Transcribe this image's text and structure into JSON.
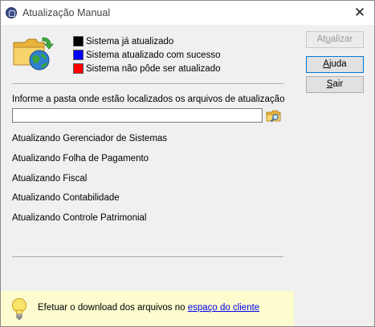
{
  "window": {
    "title": "Atualização Manual"
  },
  "legend": [
    {
      "label": "Sistema já atualizado",
      "color": "#000000"
    },
    {
      "label": "Sistema atualizado com sucesso",
      "color": "#0000ff"
    },
    {
      "label": "Sistema não pôde ser atualizado",
      "color": "#ff0000"
    }
  ],
  "folder": {
    "prompt": "Informe a pasta onde estão localizados os arquivos de atualização",
    "value": "",
    "placeholder": ""
  },
  "status_lines": [
    "Atualizando Gerenciador de Sistemas",
    "Atualizando Folha de Pagamento",
    "Atualizando Fiscal",
    "Atualizando Contabilidade",
    "Atualizando Controle Patrimonial"
  ],
  "buttons": {
    "update": {
      "label_pre": "At",
      "mnemonic": "u",
      "label_post": "alizar",
      "enabled": false
    },
    "help": {
      "label_pre": "",
      "mnemonic": "A",
      "label_post": "juda"
    },
    "exit": {
      "label_pre": "",
      "mnemonic": "S",
      "label_post": "air"
    }
  },
  "footer": {
    "text": "Efetuar o download dos arquivos no",
    "link": "espaço do cliente"
  },
  "icons": {
    "app": "app-icon",
    "folder": "folder-globe-icon",
    "browse": "browse-folder-icon",
    "tip": "lightbulb-icon",
    "close": "close-icon"
  }
}
